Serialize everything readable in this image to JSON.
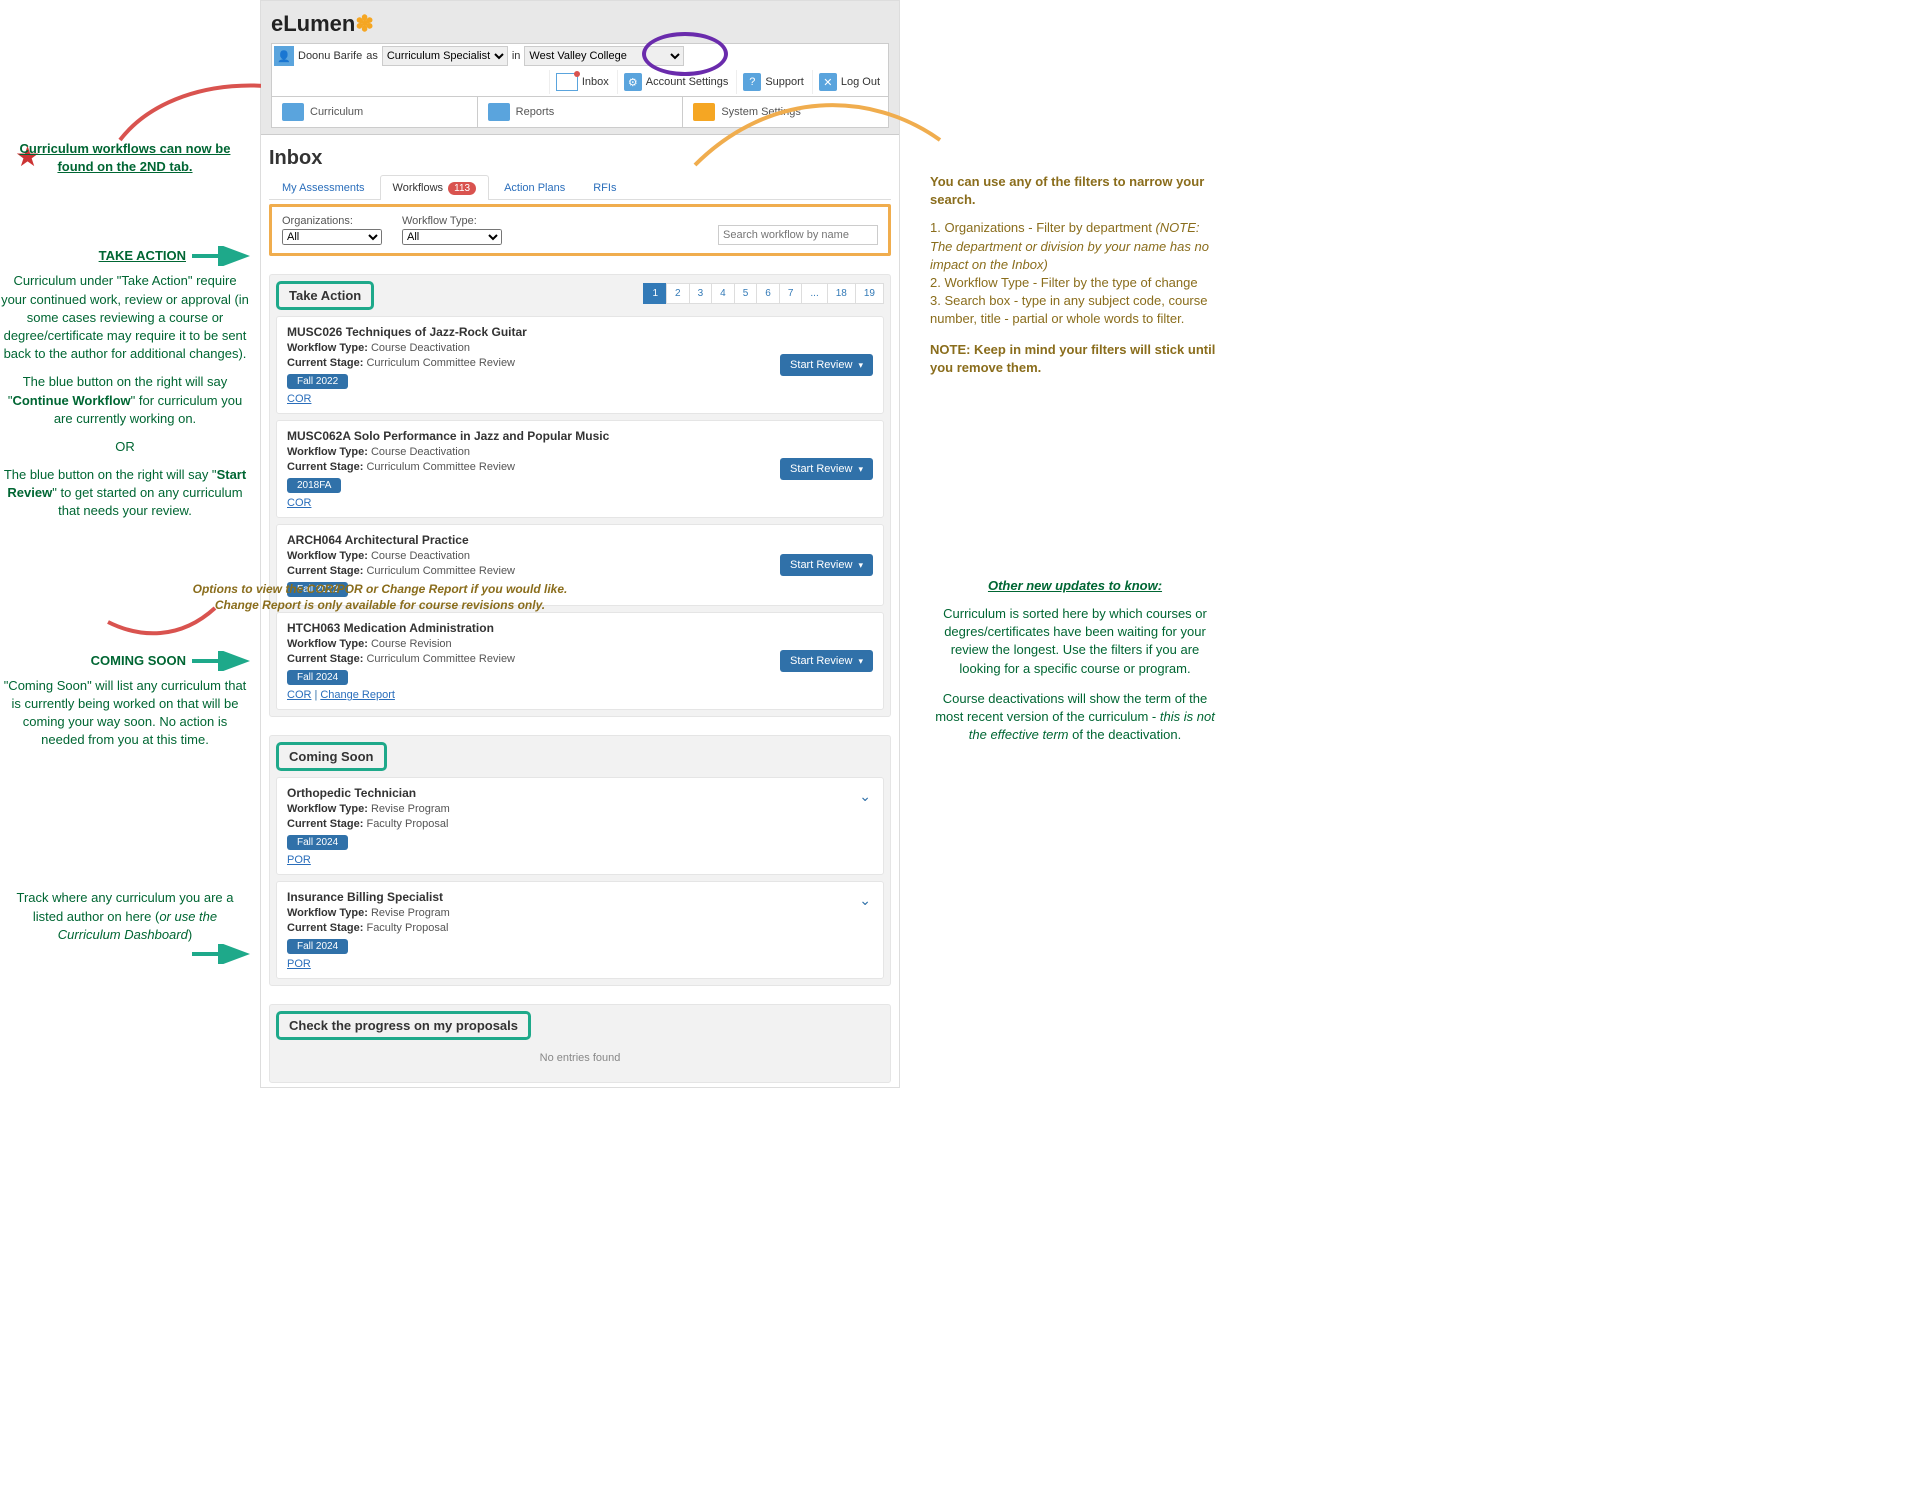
{
  "logo": {
    "text_a": "eLumen",
    "text_b": "✽"
  },
  "userbar": {
    "username": "Doonu Barife",
    "as": "as",
    "role": "Curriculum Specialist",
    "in": "in",
    "org": "West Valley College",
    "inbox": "Inbox",
    "account": "Account Settings",
    "support": "Support",
    "logout": "Log Out"
  },
  "mainnav": {
    "curriculum": "Curriculum",
    "reports": "Reports",
    "system": "System Settings"
  },
  "page": {
    "title": "Inbox"
  },
  "tabs": {
    "assessments": "My Assessments",
    "workflows": "Workflows",
    "workflows_badge": "113",
    "action_plans": "Action Plans",
    "rfis": "RFIs"
  },
  "filters": {
    "org_label": "Organizations:",
    "org_value": "All",
    "type_label": "Workflow Type:",
    "type_value": "All",
    "search_placeholder": "Search workflow by name"
  },
  "sections": {
    "take_action": "Take Action",
    "coming_soon": "Coming Soon",
    "proposals": "Check the progress on my proposals",
    "no_entries": "No entries found"
  },
  "pagination": [
    "1",
    "2",
    "3",
    "4",
    "5",
    "6",
    "7",
    "...",
    "18",
    "19"
  ],
  "take_action_items": [
    {
      "title": "MUSC026 Techniques of Jazz-Rock Guitar",
      "wtype": "Course Deactivation",
      "stage": "Curriculum Committee Review",
      "term": "Fall 2022",
      "links": [
        "COR"
      ],
      "button": "Start Review"
    },
    {
      "title": "MUSC062A Solo Performance in Jazz and Popular Music",
      "wtype": "Course Deactivation",
      "stage": "Curriculum Committee Review",
      "term": "2018FA",
      "links": [
        "COR"
      ],
      "button": "Start Review"
    },
    {
      "title": "ARCH064 Architectural Practice",
      "wtype": "Course Deactivation",
      "stage": "Curriculum Committee Review",
      "term": "Fall 2022",
      "links": [],
      "button": "Start Review"
    },
    {
      "title": "HTCH063 Medication Administration",
      "wtype": "Course Revision",
      "stage": "Curriculum Committee Review",
      "term": "Fall 2024",
      "links": [
        "COR",
        "Change Report"
      ],
      "button": "Start Review"
    }
  ],
  "coming_soon_items": [
    {
      "title": "Orthopedic Technician",
      "wtype": "Revise Program",
      "stage": "Faculty Proposal",
      "term": "Fall 2024",
      "links": [
        "POR"
      ]
    },
    {
      "title": "Insurance Billing Specialist",
      "wtype": "Revise Program",
      "stage": "Faculty Proposal",
      "term": "Fall 2024",
      "links": [
        "POR"
      ]
    }
  ],
  "labels": {
    "workflow_type": "Workflow Type:",
    "current_stage": "Current Stage:"
  },
  "annotations": {
    "left_top": "Curriculum workflows can now be found on the 2ND tab.",
    "take_action_head": "TAKE ACTION",
    "take_action_body1": "Curriculum under \"Take Action\" require your continued work, review or approval (in some cases reviewing a course or degree/certificate may require it to be sent back to the author for additional changes).",
    "take_action_body2a": "The blue button on the right will say \"",
    "take_action_body2b": "Continue Workflow",
    "take_action_body2c": "\" for curriculum you are currently working on.",
    "or": "OR",
    "take_action_body3a": "The blue button on the right will say \"",
    "take_action_body3b": "Start Review",
    "take_action_body3c": "\" to get started on any curriculum that needs your review.",
    "coming_soon_head": "COMING SOON",
    "coming_soon_body": "\"Coming Soon\" will list any curriculum that is currently being worked on that will be coming your way soon. No action is needed from you at this time.",
    "proposals_body1": "Track where any curriculum you are a listed author on here (",
    "proposals_body2": "or use the Curriculum Dashboard",
    "proposals_body3": ")",
    "right_top": "You can use any of the filters to narrow your search.",
    "right_1a": "1. Organizations - Filter by department ",
    "right_1b": "(NOTE: The department or division by your name has no impact on the Inbox)",
    "right_2": "2. Workflow Type - Filter by the type of change",
    "right_3": "3. Search box - type in any subject code, course number, title - partial or whole words to filter.",
    "right_note": "NOTE: Keep in mind your filters will stick until you remove them.",
    "right_updates_head": "Other new updates to know:",
    "right_updates_1": "Curriculum is sorted here by which courses or degres/certificates have been waiting for your review the longest. Use the filters if you are looking for a specific course or program.",
    "right_updates_2a": "Course deactivations will show the term of the most recent version of the curriculum - ",
    "right_updates_2b": "this is not the effective term",
    "right_updates_2c": " of the deactivation.",
    "cor_overlay1": "Options to view the COR/POR or Change Report if you would like.",
    "cor_overlay2": "Change Report is only available for course revisions only."
  }
}
